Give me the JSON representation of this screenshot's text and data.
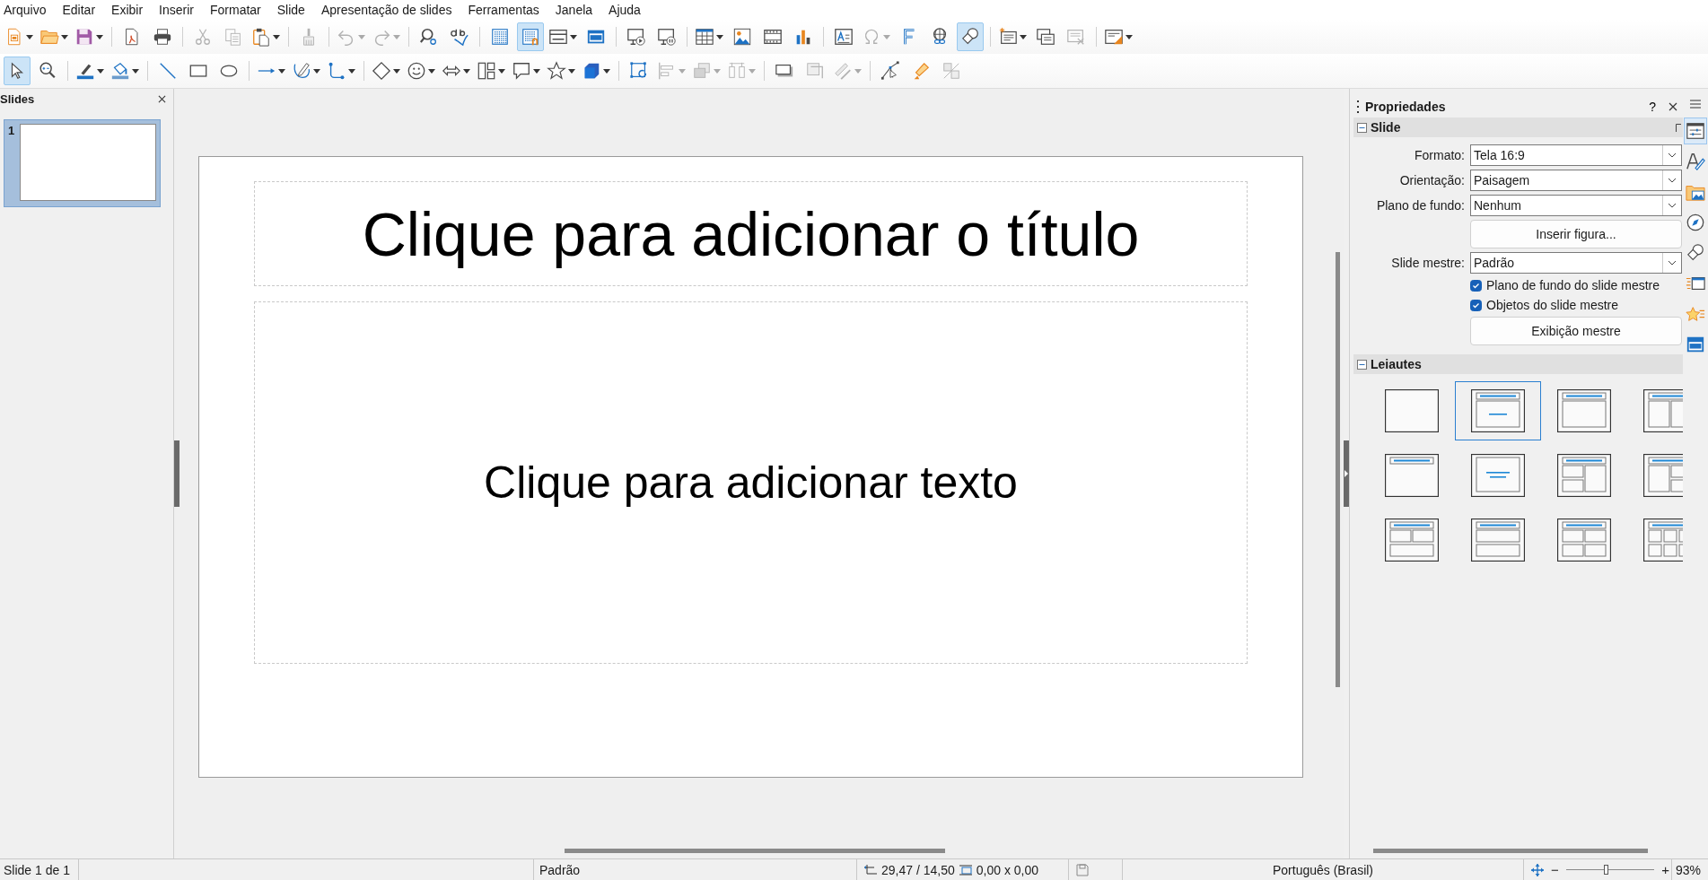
{
  "menu_bar": [
    "Arquivo",
    "Editar",
    "Exibir",
    "Inserir",
    "Formatar",
    "Slide",
    "Apresentação de slides",
    "Ferramentas",
    "Janela",
    "Ajuda"
  ],
  "toolbars": [
    {
      "groups": [
        [
          {
            "dropdown": true,
            "selected": false,
            "disabled": false
          },
          {
            "dropdown": true,
            "selected": false,
            "disabled": false
          },
          {
            "dropdown": true,
            "selected": false,
            "disabled": false
          }
        ],
        [
          {
            "dropdown": false,
            "selected": false,
            "disabled": false
          },
          {
            "dropdown": false,
            "selected": false,
            "disabled": false
          }
        ],
        [
          {
            "dropdown": false,
            "selected": false,
            "disabled": true
          },
          {
            "dropdown": false,
            "selected": false,
            "disabled": true
          },
          {
            "dropdown": true,
            "selected": false,
            "disabled": false
          }
        ],
        [
          {
            "dropdown": false,
            "selected": false,
            "disabled": true
          }
        ],
        [
          {
            "dropdown": true,
            "selected": false,
            "disabled": true
          },
          {
            "dropdown": true,
            "selected": false,
            "disabled": true
          }
        ],
        [
          {
            "dropdown": false,
            "selected": false,
            "disabled": false
          },
          {
            "dropdown": false,
            "selected": false,
            "disabled": false
          }
        ],
        [
          {
            "dropdown": false,
            "selected": false,
            "disabled": false
          },
          {
            "dropdown": false,
            "selected": true,
            "disabled": false
          },
          {
            "dropdown": true,
            "selected": false,
            "disabled": false
          },
          {
            "dropdown": false,
            "selected": false,
            "disabled": false
          }
        ],
        [
          {
            "dropdown": false,
            "selected": false,
            "disabled": false
          },
          {
            "dropdown": false,
            "selected": false,
            "disabled": false
          }
        ],
        [
          {
            "dropdown": true,
            "selected": false,
            "disabled": false
          },
          {
            "dropdown": false,
            "selected": false,
            "disabled": false
          },
          {
            "dropdown": false,
            "selected": false,
            "disabled": false
          },
          {
            "dropdown": false,
            "selected": false,
            "disabled": false
          }
        ],
        [
          {
            "dropdown": false,
            "selected": false,
            "disabled": false
          },
          {
            "dropdown": true,
            "selected": false,
            "disabled": true
          },
          {
            "dropdown": false,
            "selected": false,
            "disabled": false
          },
          {
            "dropdown": false,
            "selected": false,
            "disabled": false
          },
          {
            "dropdown": false,
            "selected": true,
            "disabled": false
          }
        ],
        [
          {
            "dropdown": true,
            "selected": false,
            "disabled": false
          },
          {
            "dropdown": false,
            "selected": false,
            "disabled": false
          },
          {
            "dropdown": false,
            "selected": false,
            "disabled": true
          }
        ],
        [
          {
            "dropdown": true,
            "selected": false,
            "disabled": false
          }
        ]
      ]
    },
    {
      "groups": [
        [
          {
            "dropdown": false,
            "selected": true,
            "disabled": false
          },
          {
            "dropdown": false,
            "selected": false,
            "disabled": false
          }
        ],
        [
          {
            "dropdown": true,
            "selected": false,
            "disabled": false
          },
          {
            "dropdown": true,
            "selected": false,
            "disabled": false
          }
        ],
        [
          {
            "dropdown": false,
            "selected": false,
            "disabled": false
          },
          {
            "dropdown": false,
            "selected": false,
            "disabled": false
          },
          {
            "dropdown": false,
            "selected": false,
            "disabled": false
          }
        ],
        [
          {
            "dropdown": true,
            "selected": false,
            "disabled": false
          },
          {
            "dropdown": true,
            "selected": false,
            "disabled": false
          },
          {
            "dropdown": true,
            "selected": false,
            "disabled": false
          }
        ],
        [
          {
            "dropdown": true,
            "selected": false,
            "disabled": false
          },
          {
            "dropdown": true,
            "selected": false,
            "disabled": false
          },
          {
            "dropdown": true,
            "selected": false,
            "disabled": false
          },
          {
            "dropdown": true,
            "selected": false,
            "disabled": false
          },
          {
            "dropdown": true,
            "selected": false,
            "disabled": false
          },
          {
            "dropdown": true,
            "selected": false,
            "disabled": false
          },
          {
            "dropdown": true,
            "selected": false,
            "disabled": false
          }
        ],
        [
          {
            "dropdown": false,
            "selected": false,
            "disabled": false
          },
          {
            "dropdown": true,
            "selected": false,
            "disabled": true
          },
          {
            "dropdown": true,
            "selected": false,
            "disabled": true
          },
          {
            "dropdown": true,
            "selected": false,
            "disabled": true
          }
        ],
        [
          {
            "dropdown": false,
            "selected": false,
            "disabled": false
          },
          {
            "dropdown": false,
            "selected": false,
            "disabled": true
          },
          {
            "dropdown": true,
            "selected": false,
            "disabled": true
          }
        ],
        [
          {
            "dropdown": false,
            "selected": false,
            "disabled": false
          },
          {
            "dropdown": false,
            "selected": false,
            "disabled": false
          },
          {
            "dropdown": false,
            "selected": false,
            "disabled": true
          }
        ]
      ]
    }
  ],
  "slides_pane": {
    "title": "Slides",
    "slides": [
      {
        "number": "1",
        "selected": true
      }
    ]
  },
  "slide": {
    "title_placeholder": "Clique para adicionar o título",
    "body_placeholder": "Clique para adicionar texto"
  },
  "sidebar": {
    "title": "Propriedades",
    "help": "?",
    "slide_section": {
      "title": "Slide",
      "expanded": true,
      "items": [
        {
          "kind": "combo",
          "label": "Formato:",
          "value": "Tela 16:9"
        },
        {
          "kind": "combo",
          "label": "Orientação:",
          "value": "Paisagem"
        },
        {
          "kind": "combo",
          "label": "Plano de fundo:",
          "value": "Nenhum"
        },
        {
          "kind": "button",
          "label": "Inserir figura..."
        },
        {
          "kind": "combo",
          "label": "Slide mestre:",
          "value": "Padrão"
        },
        {
          "kind": "checkbox",
          "label": "Plano de fundo do slide mestre",
          "checked": true
        },
        {
          "kind": "checkbox",
          "label": "Objetos do slide mestre",
          "checked": true
        },
        {
          "kind": "button",
          "label": "Exibição mestre"
        }
      ]
    },
    "layouts_section": {
      "title": "Leiautes",
      "expanded": true,
      "layouts": [
        {
          "selected": false
        },
        {
          "selected": true
        },
        {
          "selected": false
        },
        {
          "selected": false
        },
        {
          "selected": false
        },
        {
          "selected": false
        },
        {
          "selected": false
        },
        {
          "selected": false
        },
        {
          "selected": false
        },
        {
          "selected": false
        },
        {
          "selected": false
        },
        {
          "selected": false
        }
      ]
    },
    "tabs": [
      {
        "selected": true
      },
      {
        "selected": false
      },
      {
        "selected": false
      },
      {
        "selected": false
      },
      {
        "selected": false
      },
      {
        "selected": false
      },
      {
        "selected": false
      },
      {
        "selected": false
      }
    ]
  },
  "status_bar": {
    "slide": "Slide 1 de 1",
    "master": "Padrão",
    "position": "29,47 / 14,50",
    "size": "0,00 x 0,00",
    "language": "Português (Brasil)",
    "zoom_out": "−",
    "zoom_in": "+",
    "zoom": {
      "level": 0.45,
      "reading": "93%"
    }
  }
}
